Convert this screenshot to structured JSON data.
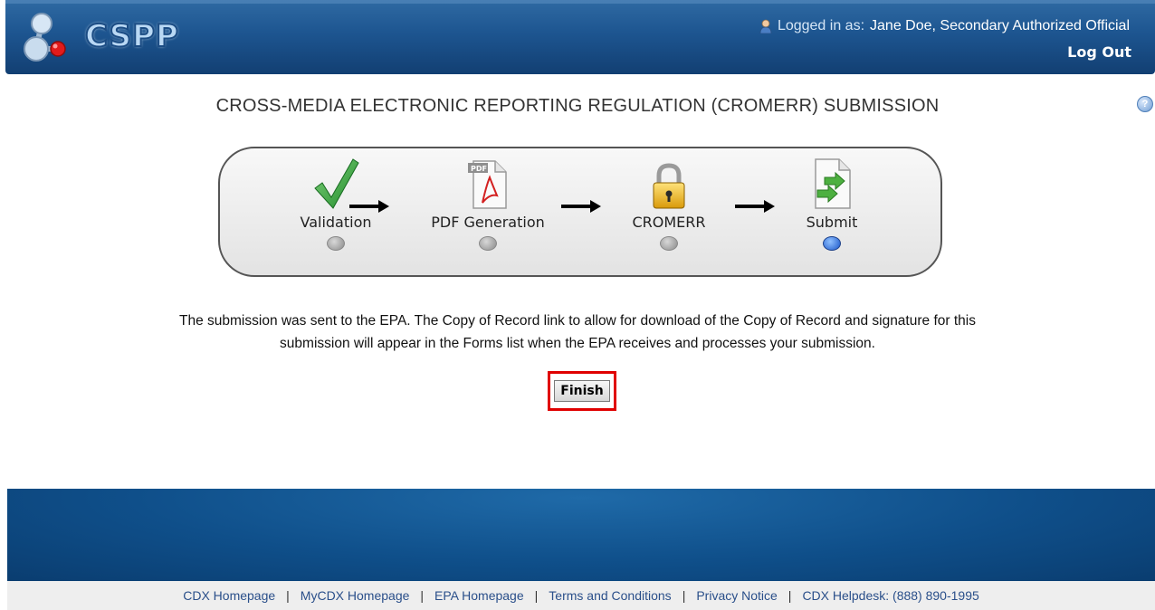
{
  "header": {
    "logo_text": "CSPP",
    "logged_in_prefix": "Logged in as:",
    "user_name": "Jane Doe, Secondary Authorized Official",
    "logout_label": "Log Out"
  },
  "help": {
    "icon": "help-icon"
  },
  "page_title": "CROSS-MEDIA ELECTRONIC REPORTING REGULATION (CROMERR) SUBMISSION",
  "steps": [
    {
      "label": "Validation",
      "icon": "checkmark-icon",
      "active": false
    },
    {
      "label": "PDF Generation",
      "icon": "pdf-file-icon",
      "active": false
    },
    {
      "label": "CROMERR",
      "icon": "padlock-icon",
      "active": false
    },
    {
      "label": "Submit",
      "icon": "submit-document-icon",
      "active": true
    }
  ],
  "message": {
    "line1": "The submission was sent to the EPA. The Copy of Record link to allow for download of the Copy of Record and signature for this",
    "line2": "submission will appear in the Forms list when the EPA receives and processes your submission."
  },
  "finish_label": "Finish",
  "footer": {
    "links": [
      "CDX Homepage",
      "MyCDX Homepage",
      "EPA Homepage",
      "Terms and Conditions",
      "Privacy Notice",
      "CDX Helpdesk: (888) 890-1995"
    ],
    "separator": "|"
  },
  "colors": {
    "header_blue": "#1d5590",
    "active_dot": "#1a56c9",
    "highlight_red": "#e00000",
    "link_blue": "#2a4f8a"
  }
}
